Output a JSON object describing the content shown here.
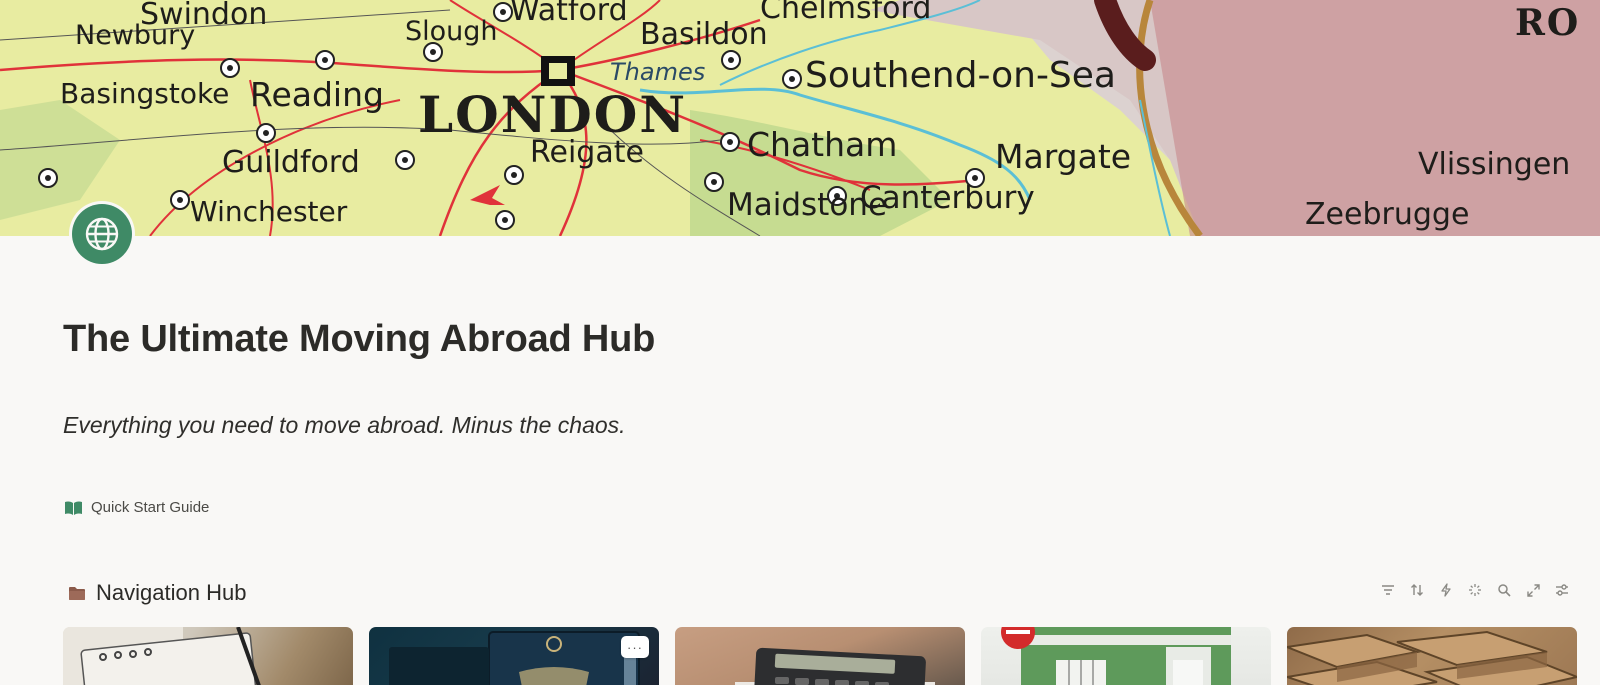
{
  "cover": {
    "map_labels": {
      "swindon": "Swindon",
      "watford": "Watford",
      "chelmsford": "Chelmsford",
      "newbury": "Newbury",
      "slough": "Slough",
      "basildon": "Basildon",
      "basingstoke": "Basingstoke",
      "reading": "Reading",
      "london": "LONDON",
      "thames": "Thames",
      "southend": "Southend-on-Sea",
      "reigate": "Reigate",
      "chatham": "Chatham",
      "margate": "Margate",
      "guildford": "Guildford",
      "maidstone": "Maidstone",
      "canterbury": "Canterbury",
      "winchester": "Winchester",
      "vlissingen": "Vlissingen",
      "zeebrugge": "Zeebrugge",
      "ro": "RO"
    }
  },
  "page": {
    "icon": "globe-icon",
    "title": "The Ultimate Moving Abroad Hub",
    "subtitle": "Everything you need to move abroad. Minus the chaos."
  },
  "quick_start": {
    "icon": "open-book-icon",
    "label": "Quick Start Guide"
  },
  "navigation_hub": {
    "icon": "folder-icon",
    "title": "Navigation Hub",
    "toolbar_icons": [
      "filter-icon",
      "sort-icon",
      "lightning-icon",
      "sparkle-icon",
      "search-icon",
      "expand-icon",
      "settings-icon"
    ],
    "card_menu_label": "···"
  },
  "colors": {
    "accent_green": "#3f8a66",
    "background": "#f9f8f6",
    "folder": "#8b5a4a"
  }
}
